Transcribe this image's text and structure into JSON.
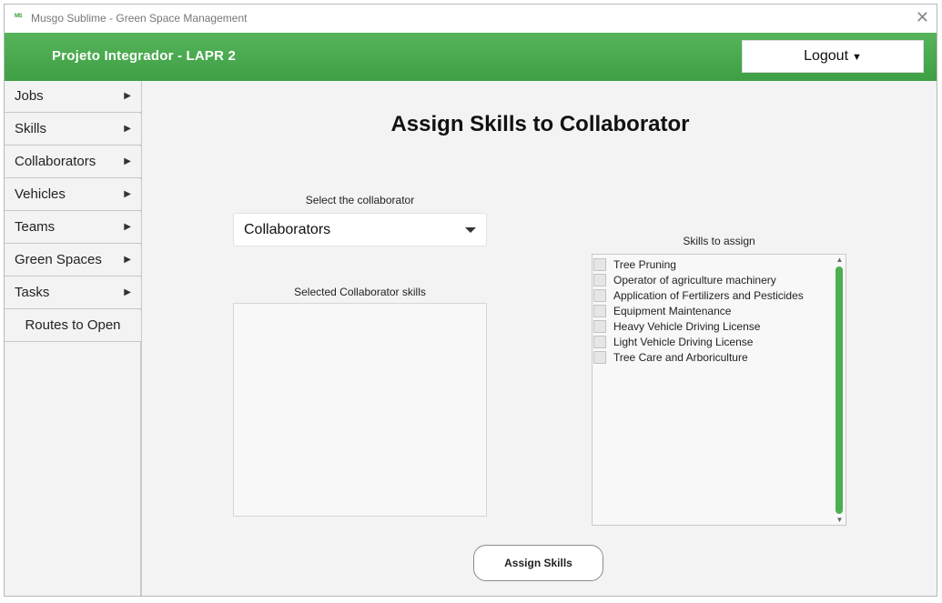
{
  "window": {
    "icon_text": "MS",
    "title": "Musgo Sublime - Green Space Management",
    "close_glyph": "✕"
  },
  "header": {
    "title": "Projeto Integrador - LAPR 2",
    "logout_label": "Logout",
    "logout_icon": "arrow-down-icon"
  },
  "sidebar": {
    "items": [
      {
        "label": "Jobs",
        "arrow": "▶"
      },
      {
        "label": "Skills",
        "arrow": "▶"
      },
      {
        "label": "Collaborators",
        "arrow": "▶"
      },
      {
        "label": "Vehicles",
        "arrow": "▶"
      },
      {
        "label": "Teams",
        "arrow": "▶"
      },
      {
        "label": "Green Spaces",
        "arrow": "▶"
      },
      {
        "label": "Tasks",
        "arrow": "▶"
      },
      {
        "label": "Routes to Open"
      }
    ]
  },
  "main": {
    "title": "Assign Skills to Collaborator",
    "select_label": "Select the collaborator",
    "select_value": "Collaborators",
    "selected_skills_label": "Selected Collaborator skills",
    "skills_label": "Skills to assign",
    "skills": [
      "Tree Pruning",
      "Operator of agriculture machinery",
      "Application of Fertilizers and Pesticides",
      "Equipment Maintenance",
      "Heavy Vehicle Driving License",
      "Light Vehicle Driving License",
      "Tree Care and Arboriculture"
    ],
    "assign_button": "Assign Skills"
  },
  "colors": {
    "header_green": "#45a84c",
    "scrollbar_green": "#4caf50"
  }
}
